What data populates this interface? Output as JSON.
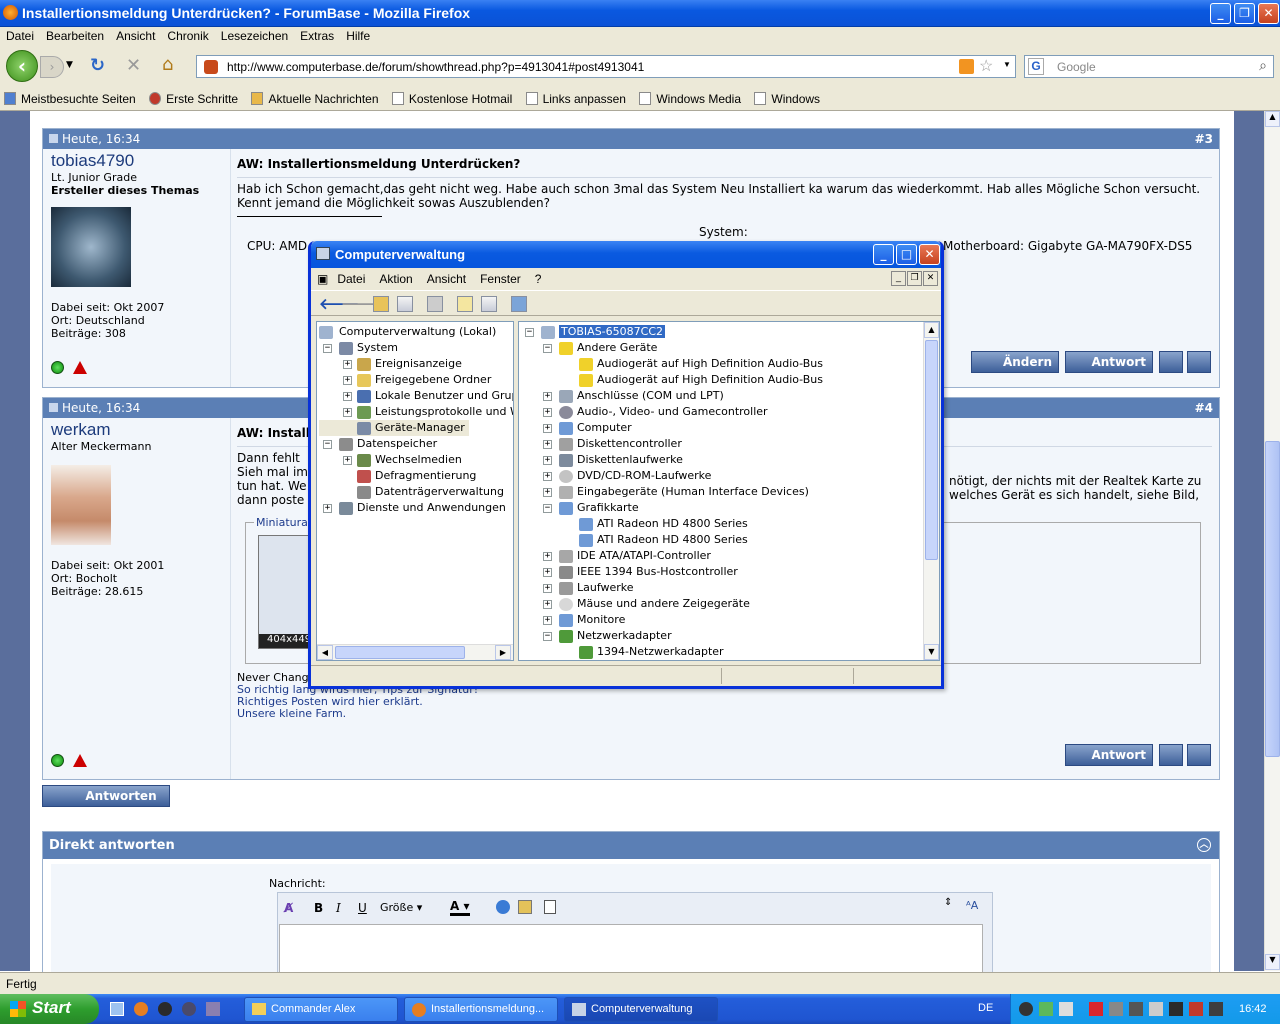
{
  "browser": {
    "title": "Installertionsmeldung Unterdrücken? - ForumBase - Mozilla Firefox",
    "menu": [
      "Datei",
      "Bearbeiten",
      "Ansicht",
      "Chronik",
      "Lesezeichen",
      "Extras",
      "Hilfe"
    ],
    "url": "http://www.computerbase.de/forum/showthread.php?p=4913041#post4913041",
    "search_placeholder": "Google",
    "bookmarks": [
      "Meistbesuchte Seiten",
      "Erste Schritte",
      "Aktuelle Nachrichten",
      "Kostenlose Hotmail",
      "Links anpassen",
      "Windows Media",
      "Windows"
    ],
    "status": "Fertig"
  },
  "post3": {
    "date": "Heute, 16:34",
    "number": "#3",
    "username": "tobias4790",
    "rank": "Lt. Junior Grade",
    "creator": "Ersteller dieses Themas",
    "joined": "Dabei seit: Okt 2007",
    "location": "Ort: Deutschland",
    "posts": "Beiträge: 308",
    "title": "AW: Installertionsmeldung Unterdrücken?",
    "body": "Hab ich Schon gemacht,das geht nicht weg. Habe auch schon 3mal das System Neu Installiert ka warum das wiederkommt. Hab alles Mögliche Schon versucht. Kennt jemand die Möglichkeit sowas Auszublenden?",
    "system_label": "System:",
    "cpu_text": "CPU: AMD",
    "mobo_text": "Motherboard: Gigabyte GA-MA790FX-DS5",
    "edit_btn": "Ändern",
    "reply_btn": "Antwort"
  },
  "post4": {
    "date": "Heute, 16:34",
    "number": "#4",
    "username": "werkam",
    "rank": "Alter Meckermann",
    "joined": "Dabei seit: Okt 2001",
    "location": "Ort: Bocholt",
    "posts": "Beiträge: 28.615",
    "title": "AW: Install",
    "body_l1": "Dann fehlt",
    "body_l2": "Sieh mal im",
    "body_l3": "tun hat. We",
    "body_l4": "dann poste",
    "body_r1": "nötigt, der nichts mit der Realtek Karte zu",
    "body_r2": "welches Gerät es sich handelt, siehe Bild,",
    "thumb_label": "Miniaturan",
    "thumb_size": "404x449",
    "sig1": "Never Change a running System!",
    "sig2": "So richtig lang wirds hier, Tips zur Signatur!",
    "sig3": "Richtiges Posten wird hier erklärt.",
    "sig4": "Unsere kleine Farm.",
    "reply_btn": "Antwort"
  },
  "answer_btn": "Antworten",
  "quick_reply": {
    "title": "Direkt antworten",
    "label": "Nachricht:",
    "size_label": "Größe"
  },
  "cv": {
    "title": "Computerverwaltung",
    "menu": [
      "Datei",
      "Aktion",
      "Ansicht",
      "Fenster",
      "?"
    ],
    "left_tree": [
      "Computerverwaltung (Lokal)",
      "System",
      "Ereignisanzeige",
      "Freigegebene Ordner",
      "Lokale Benutzer und Gruppe",
      "Leistungsprotokolle und War",
      "Geräte-Manager",
      "Datenspeicher",
      "Wechselmedien",
      "Defragmentierung",
      "Datenträgerverwaltung",
      "Dienste und Anwendungen"
    ],
    "right_tree": [
      "TOBIAS-65087CC2",
      "Andere Geräte",
      "Audiogerät auf High Definition Audio-Bus",
      "Audiogerät auf High Definition Audio-Bus",
      "Anschlüsse (COM und LPT)",
      "Audio-, Video- und Gamecontroller",
      "Computer",
      "Diskettencontroller",
      "Diskettenlaufwerke",
      "DVD/CD-ROM-Laufwerke",
      "Eingabegeräte (Human Interface Devices)",
      "Grafikkarte",
      "ATI Radeon HD 4800 Series",
      "ATI Radeon HD 4800 Series",
      "IDE ATA/ATAPI-Controller",
      "IEEE 1394 Bus-Hostcontroller",
      "Laufwerke",
      "Mäuse und andere Zeigegeräte",
      "Monitore",
      "Netzwerkadapter",
      "1394-Netzwerkadapter"
    ]
  },
  "taskbar": {
    "start": "Start",
    "tasks": [
      "Commander Alex",
      "Installertionsmeldung...",
      "Computerverwaltung"
    ],
    "lang": "DE",
    "clock": "16:42"
  }
}
